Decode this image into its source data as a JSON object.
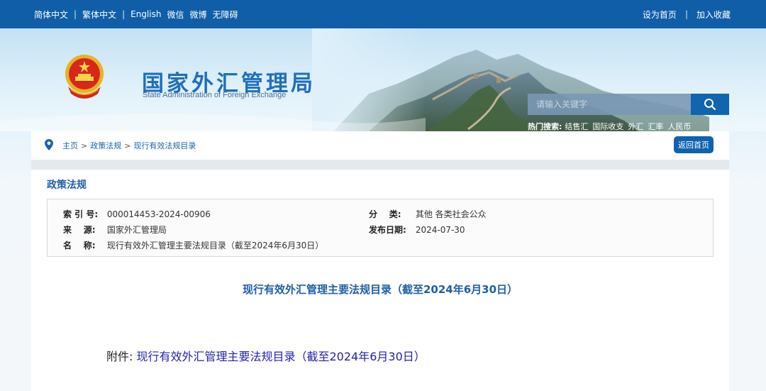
{
  "topbar": {
    "lang_simplified": "简体中文",
    "lang_traditional": "繁体中文",
    "lang_english": "English",
    "wechat": "微信",
    "weibo": "微博",
    "accessibility": "无障碍",
    "set_home": "设为首页",
    "add_favorite": "加入收藏",
    "separator": "|"
  },
  "header": {
    "title": "国家外汇管理局",
    "subtitle": "State Administration of Foreign Exchange",
    "search": {
      "placeholder": "请输入关键字",
      "icon": "search-icon"
    },
    "hot_search": {
      "label": "热门搜索:",
      "keywords": [
        "结售汇",
        "国际收支",
        "外汇",
        "汇率",
        "人民币"
      ]
    }
  },
  "breadcrumb": {
    "home": "主页",
    "level1": "政策法规",
    "level2": "现行有效法规目录",
    "arrow": ">",
    "back_button": "返回首页"
  },
  "content": {
    "section_title": "政策法规",
    "meta": {
      "index_label": "索 引 号:",
      "index_value": "000014453-2024-00906",
      "category_label": "分    类:",
      "category_value": "其他 各类社会公众",
      "source_label": "来    源:",
      "source_value": "国家外汇管理局",
      "date_label": "发布日期:",
      "date_value": "2024-07-30",
      "name_label": "名    称:",
      "name_value": "现行有效外汇管理主要法规目录（截至2024年6月30日）"
    },
    "doc_title": "现行有效外汇管理主要法规目录（截至2024年6月30日）",
    "attachment_label": "附件:",
    "attachment_link": "现行有效外汇管理主要法规目录（截至2024年6月30日）"
  },
  "colors": {
    "topbar": "#0f5ea7",
    "accent": "#1f5fa6",
    "button": "#0f62ae"
  }
}
